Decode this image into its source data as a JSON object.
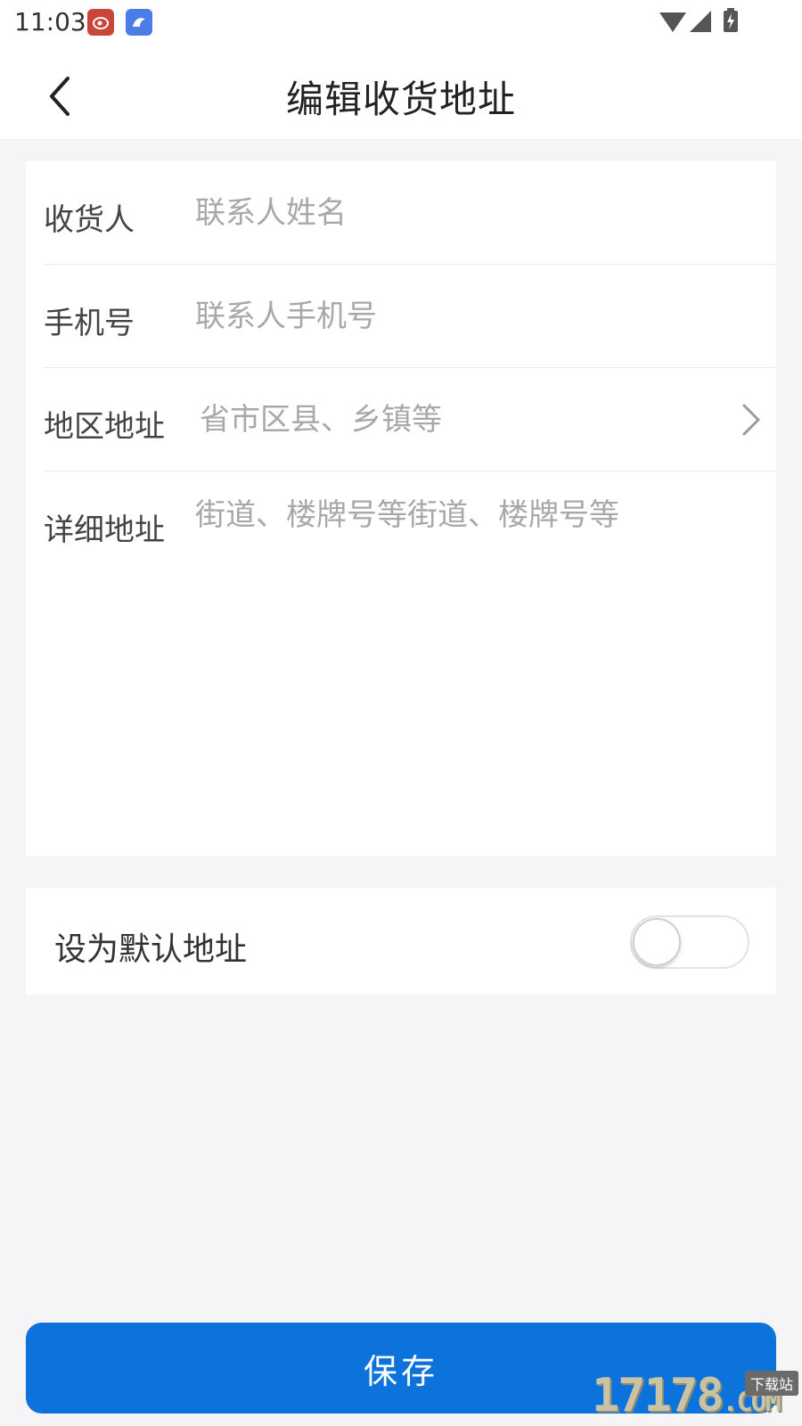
{
  "status_bar": {
    "time": "11:03",
    "notification_icons": [
      "weibo-icon",
      "bird-app-icon"
    ],
    "system_icons": [
      "wifi-icon",
      "signal-icon",
      "battery-charging-icon"
    ]
  },
  "header": {
    "back_icon": "chevron-left-icon",
    "title": "编辑收货地址"
  },
  "form": {
    "recipient": {
      "label": "收货人",
      "placeholder": "联系人姓名",
      "value": ""
    },
    "phone": {
      "label": "手机号",
      "placeholder": "联系人手机号",
      "value": ""
    },
    "region": {
      "label": "地区地址",
      "placeholder": "省市区县、乡镇等",
      "value": "",
      "icon": "chevron-right-icon"
    },
    "detail": {
      "label": "详细地址",
      "placeholder": "街道、楼牌号等街道、楼牌号等",
      "value": ""
    }
  },
  "default_address": {
    "label": "设为默认地址",
    "enabled": false
  },
  "save_button": {
    "label": "保存",
    "color": "#0c72dc"
  },
  "watermark": {
    "text": "17178",
    "domain": ".COM",
    "badge": "下载站"
  }
}
